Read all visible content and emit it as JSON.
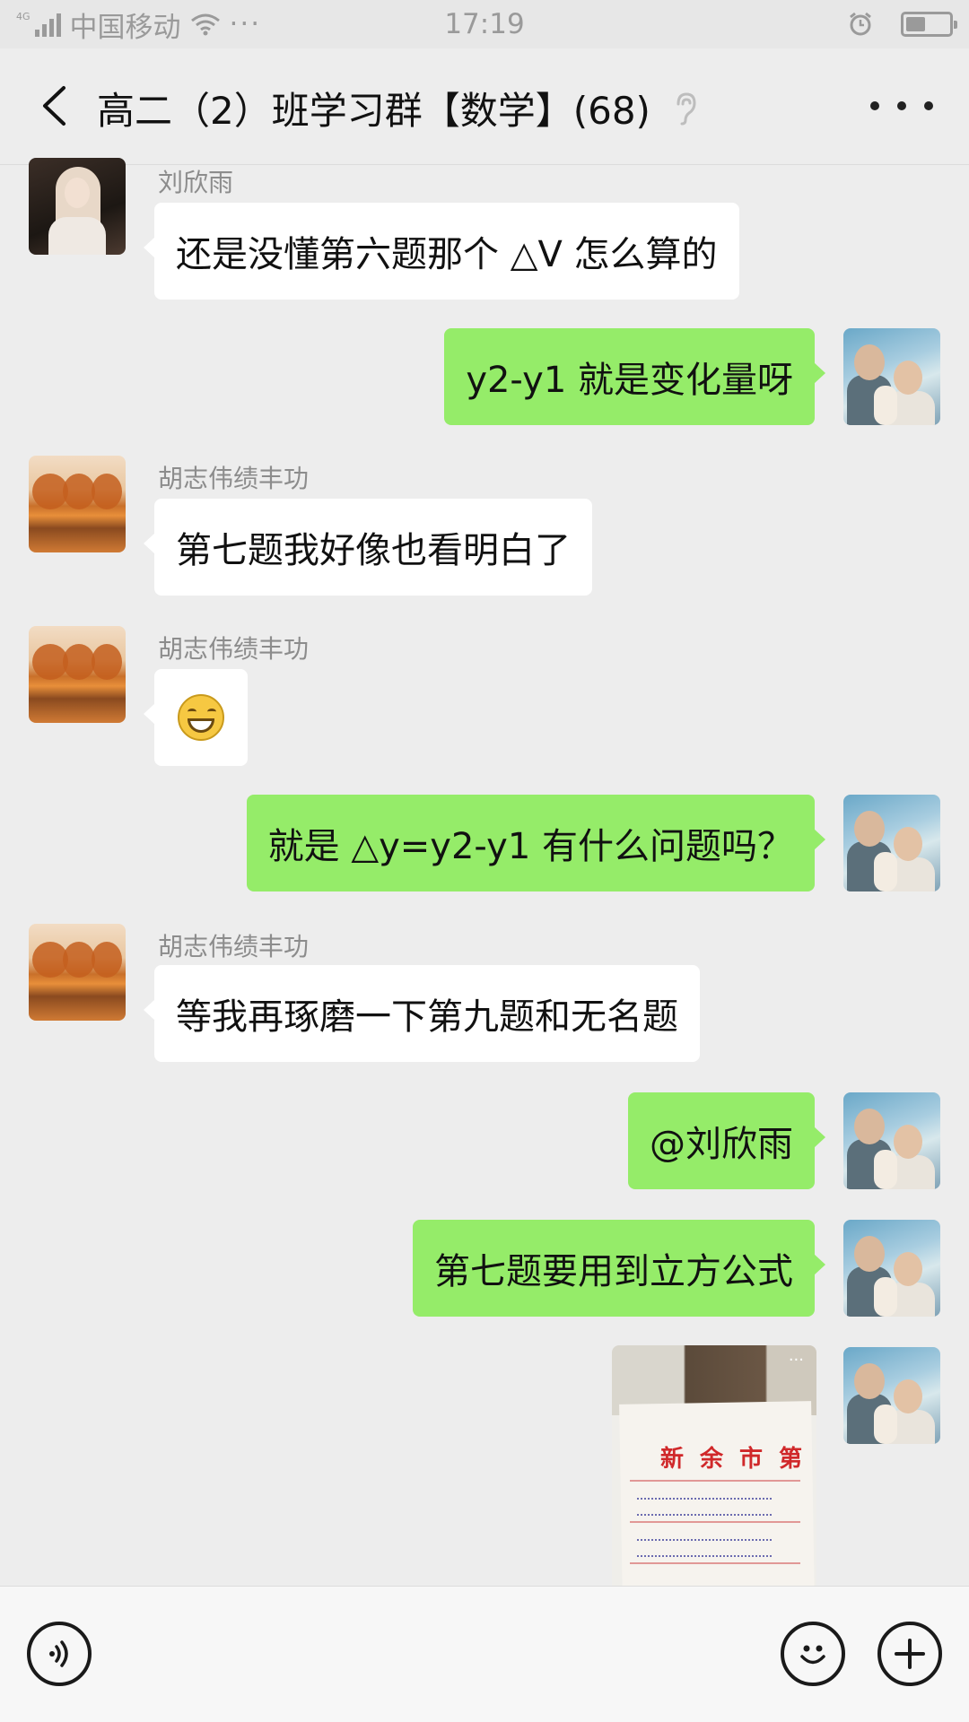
{
  "status_bar": {
    "carrier": "中国移动",
    "network": "4G",
    "time": "17:19",
    "battery_percent": 45
  },
  "header": {
    "title": "高二（2）班学习群【数学】(68)"
  },
  "messages": [
    {
      "side": "in",
      "sender": "刘欣雨",
      "text": "还是没懂第六题那个 △V 怎么算的"
    },
    {
      "side": "out",
      "text": "y2-y1 就是变化量呀"
    },
    {
      "side": "in",
      "sender": "胡志伟绩丰功",
      "text": "第七题我好像也看明白了"
    },
    {
      "side": "in",
      "sender": "胡志伟绩丰功",
      "emoji": "grinning-face"
    },
    {
      "side": "out",
      "text": "就是 △y=y2-y1 有什么问题吗？"
    },
    {
      "side": "in",
      "sender": "胡志伟绩丰功",
      "text": "等我再琢磨一下第九题和无名题"
    },
    {
      "side": "out",
      "text": "@刘欣雨"
    },
    {
      "side": "out",
      "text": "第七题要用到立方公式"
    },
    {
      "side": "out",
      "image": {
        "heading": "新余市第"
      }
    }
  ],
  "colors": {
    "outgoing_bubble": "#95ec69",
    "incoming_bubble": "#ffffff",
    "background": "#ededed"
  }
}
